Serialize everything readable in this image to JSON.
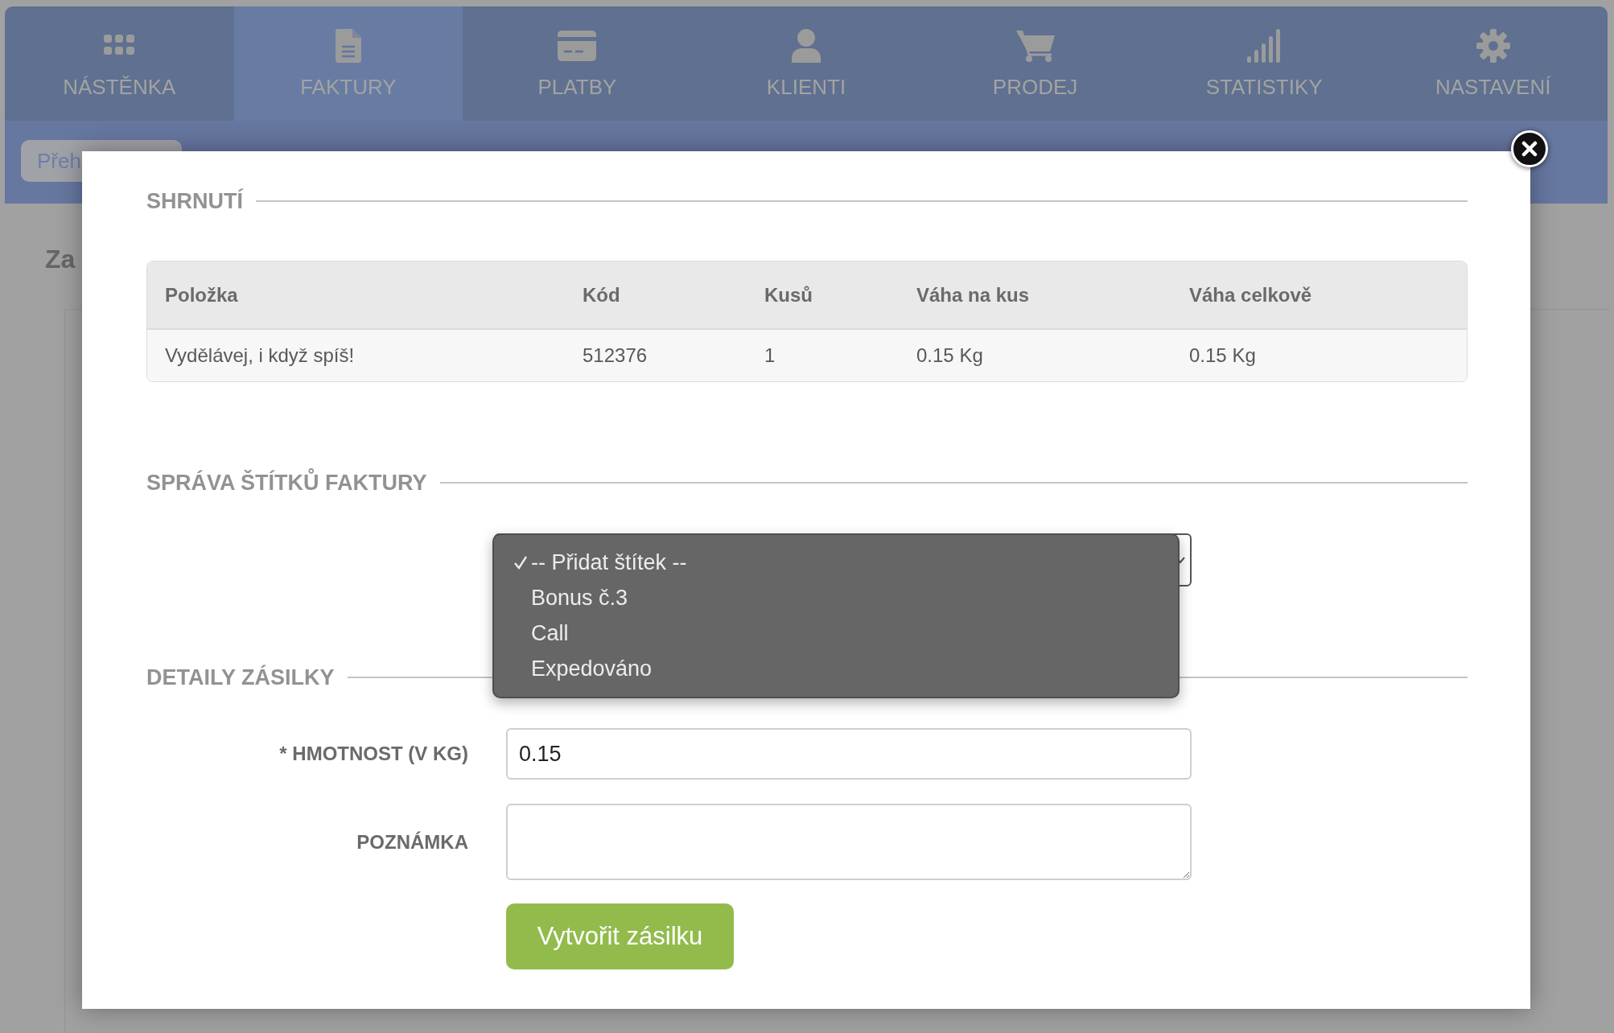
{
  "nav": {
    "items": [
      {
        "label": "NÁSTĚNKA",
        "selected": false
      },
      {
        "label": "FAKTURY",
        "selected": true
      },
      {
        "label": "PLATBY",
        "selected": false
      },
      {
        "label": "KLIENTI",
        "selected": false
      },
      {
        "label": "PRODEJ",
        "selected": false
      },
      {
        "label": "STATISTIKY",
        "selected": false
      },
      {
        "label": "NASTAVENÍ",
        "selected": false
      }
    ]
  },
  "background": {
    "breadcrumb_button": "Přeh",
    "heading": "Za"
  },
  "modal": {
    "summary": {
      "title": "SHRNUTÍ",
      "table": {
        "columns": [
          "Položka",
          "Kód",
          "Kusů",
          "Váha na kus",
          "Váha celkově"
        ],
        "rows": [
          [
            "Vydělávej, i když spíš!",
            "512376",
            "1",
            "0.15 Kg",
            "0.15 Kg"
          ]
        ]
      }
    },
    "labels": {
      "title": "SPRÁVA ŠTÍTKŮ FAKTURY",
      "select": {
        "expanded": true,
        "options": [
          {
            "label": "-- Přidat štítek --",
            "selected": true
          },
          {
            "label": "Bonus č.3",
            "selected": false
          },
          {
            "label": "Call",
            "selected": false
          },
          {
            "label": "Expedováno",
            "selected": false
          }
        ]
      }
    },
    "shipment": {
      "title": "DETAILY ZÁSILKY",
      "fields": [
        {
          "kind": "input",
          "label": "* HMOTNOST (V KG)",
          "value": "0.15"
        },
        {
          "kind": "textarea",
          "label": "POZNÁMKA"
        }
      ],
      "submit": "Vytvořit zásilku"
    }
  }
}
